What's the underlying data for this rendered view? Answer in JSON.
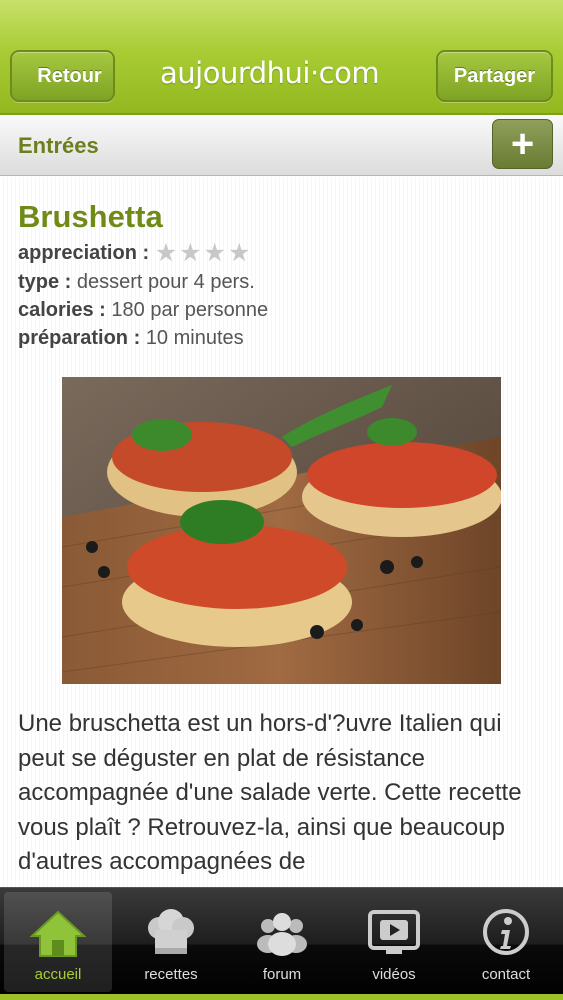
{
  "header": {
    "back_label": "Retour",
    "logo_text": "aujourdhui·com",
    "share_label": "Partager"
  },
  "category": {
    "title": "Entrées",
    "add_label": "+"
  },
  "recipe": {
    "title": "Brushetta",
    "rating_label": "appreciation :",
    "rating_value": 0,
    "rating_max": 4,
    "type_label": "type :",
    "type_value": "dessert pour 4 pers.",
    "calories_label": "calories :",
    "calories_value": "180 par personne",
    "prep_label": "préparation :",
    "prep_value": "10 minutes",
    "description": "Une bruschetta est un hors-d'?uvre Italien qui peut se déguster en plat de résistance accompagnée d'une salade verte. Cette recette vous plaît ? Retrouvez-la, ainsi que beaucoup d'autres accompagnées de"
  },
  "tabs": [
    {
      "label": "accueil",
      "icon": "home-icon",
      "active": true
    },
    {
      "label": "recettes",
      "icon": "chef-hat-icon",
      "active": false
    },
    {
      "label": "forum",
      "icon": "people-icon",
      "active": false
    },
    {
      "label": "vidéos",
      "icon": "video-icon",
      "active": false
    },
    {
      "label": "contact",
      "icon": "info-icon",
      "active": false
    }
  ],
  "colors": {
    "brand_green": "#9dc227",
    "title_green": "#6f8a17",
    "tab_active": "#a8cc3a"
  }
}
